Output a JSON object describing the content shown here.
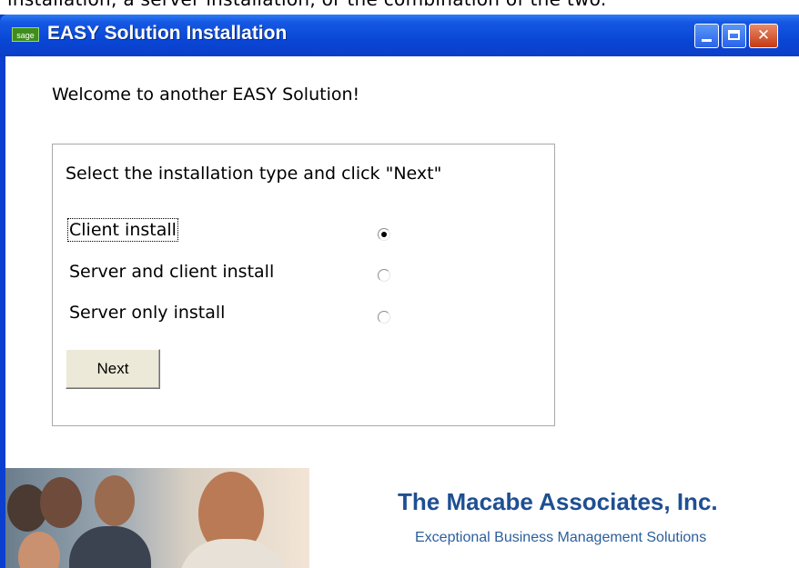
{
  "background_caption": "installation, a server installation, or the combination of the two.",
  "window": {
    "logo_text": "sage",
    "title": "EASY Solution Installation",
    "controls": {
      "minimize": "minimize-icon",
      "maximize": "maximize-icon",
      "close": "✕"
    }
  },
  "welcome_text": "Welcome to another EASY Solution!",
  "installer": {
    "instruction": "Select the installation type and click \"Next\"",
    "options": [
      {
        "label": "Client install",
        "selected": true
      },
      {
        "label": "Server and client install",
        "selected": false
      },
      {
        "label": "Server only install",
        "selected": false
      }
    ],
    "next_label": "Next"
  },
  "footer": {
    "company_name": "The Macabe Associates, Inc.",
    "tagline": "Exceptional Business Management Solutions"
  },
  "colors": {
    "titlebar": "#0a47d6",
    "company_name": "#1e4f92",
    "tagline": "#2c5e9c",
    "button_face": "#ece9d8"
  }
}
